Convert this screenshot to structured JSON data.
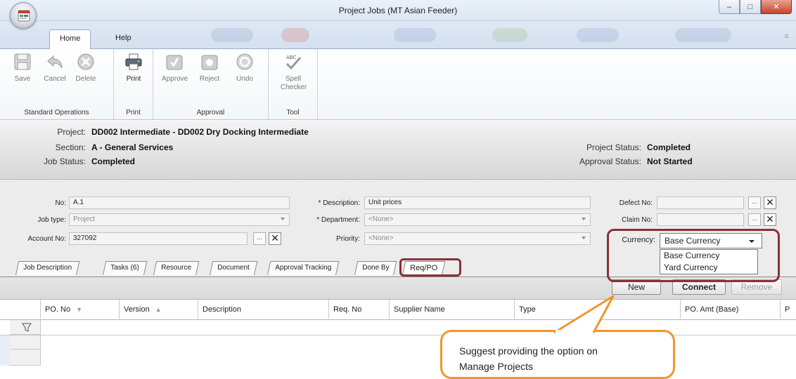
{
  "window": {
    "title": "Project Jobs (MT Asian Feeder)",
    "buttons": [
      "–",
      "□",
      "✕"
    ]
  },
  "ribbon_tabs": [
    "Home",
    "Help"
  ],
  "ribbon": {
    "collapse_glyph": "⌂",
    "groups": [
      {
        "label": "Standard Operations",
        "buttons": [
          "Save",
          "Cancel",
          "Delete"
        ]
      },
      {
        "label": "Print",
        "buttons": [
          "Print"
        ]
      },
      {
        "label": "Approval",
        "buttons": [
          "Approve",
          "Reject",
          "Undo"
        ]
      },
      {
        "label": "Tool",
        "buttons": [
          "Spell Checker"
        ]
      }
    ],
    "spell_icon_text": "ABC"
  },
  "info": {
    "project_label": "Project:",
    "project_value": "DD002 Intermediate - DD002 Dry Docking Intermediate",
    "section_label": "Section:",
    "section_value": "A - General Services",
    "job_status_label": "Job Status:",
    "job_status_value": "Completed",
    "project_status_label": "Project Status:",
    "project_status_value": "Completed",
    "approval_status_label": "Approval Status:",
    "approval_status_value": "Not Started"
  },
  "form": {
    "no_label": "No:",
    "no_value": "A.1",
    "jobtype_label": "Job type:",
    "jobtype_value": "Project",
    "account_label": "Account No:",
    "account_value": "327092",
    "description_label": "* Description:",
    "description_value": "Unit prices",
    "department_label": "* Department:",
    "department_value": "<None>",
    "priority_label": "Priority:",
    "priority_value": "<None>",
    "defect_label": "Defect No:",
    "claim_label": "Claim No:",
    "currency_label": "Currency:",
    "currency_value": "Base Currency",
    "currency_options": [
      "Base Currency",
      "Yard Currency"
    ],
    "lookup_btn": "...",
    "clear_btn": "✕"
  },
  "detail_tabs": [
    "Job Description",
    "Tasks (6)",
    "Resource",
    "Document",
    "Approval Tracking",
    "Done By",
    "Req/PO"
  ],
  "grid_toolbar": {
    "new": "New",
    "connect": "Connect",
    "remove": "Remove"
  },
  "grid": {
    "columns": [
      "PO. No",
      "Version",
      "Description",
      "Req. No",
      "Supplier Name",
      "Type",
      "PO. Amt (Base)",
      "P"
    ]
  },
  "callout": {
    "text": "Suggest providing the option on Manage Projects",
    "line1": "Suggest providing the option on",
    "line2": "Manage Projects"
  },
  "colors": {
    "highlight_border": "#8b2f3a",
    "callout_border": "#f0962e"
  }
}
